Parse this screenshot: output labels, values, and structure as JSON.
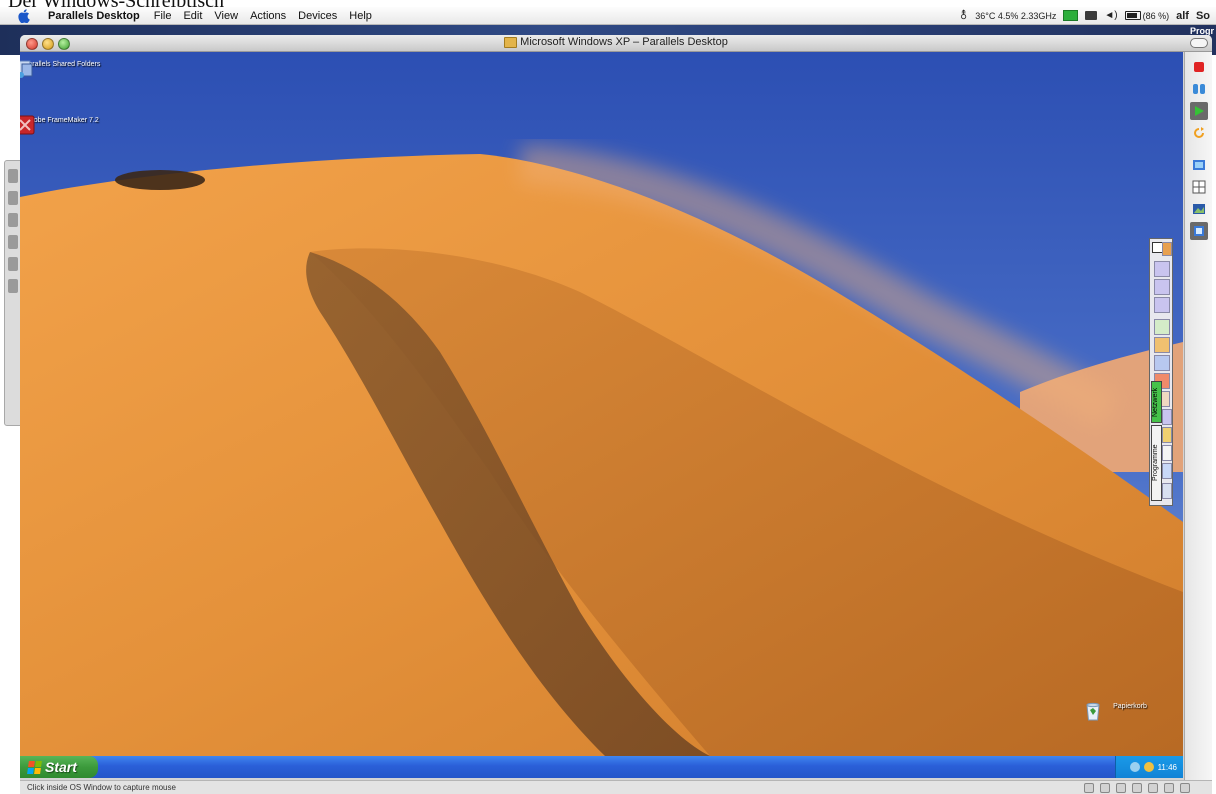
{
  "caption": "Der Windows-Schreibtisch",
  "menubar": {
    "app_name": "Parallels Desktop",
    "items": [
      "File",
      "Edit",
      "View",
      "Actions",
      "Devices",
      "Help"
    ],
    "status_text": "36°C 4.5% 2.33GHz",
    "battery": "(86 %)",
    "user": "alf",
    "clock": "So"
  },
  "right_edge_label": "Progr",
  "window": {
    "title": "Microsoft Windows XP – Parallels Desktop",
    "status_message": "Click inside OS Window to capture mouse"
  },
  "desktop": {
    "icons": [
      {
        "label": "Parallels Shared Folders",
        "icon": "shared-folder-icon"
      },
      {
        "label": "Adobe FrameMaker 7.2",
        "icon": "framemaker-icon"
      },
      {
        "label": "Papierkorb",
        "icon": "recycle-bin-icon"
      }
    ],
    "quickbar_tabs": [
      "Programme",
      "Netzwerk"
    ]
  },
  "taskbar": {
    "start_label": "Start",
    "clock": "11:46"
  },
  "colors": {
    "xp_taskbar": "#2456c9",
    "start_green": "#3c9a3c",
    "sky": "#3457b6",
    "sand": "#d88a32"
  }
}
